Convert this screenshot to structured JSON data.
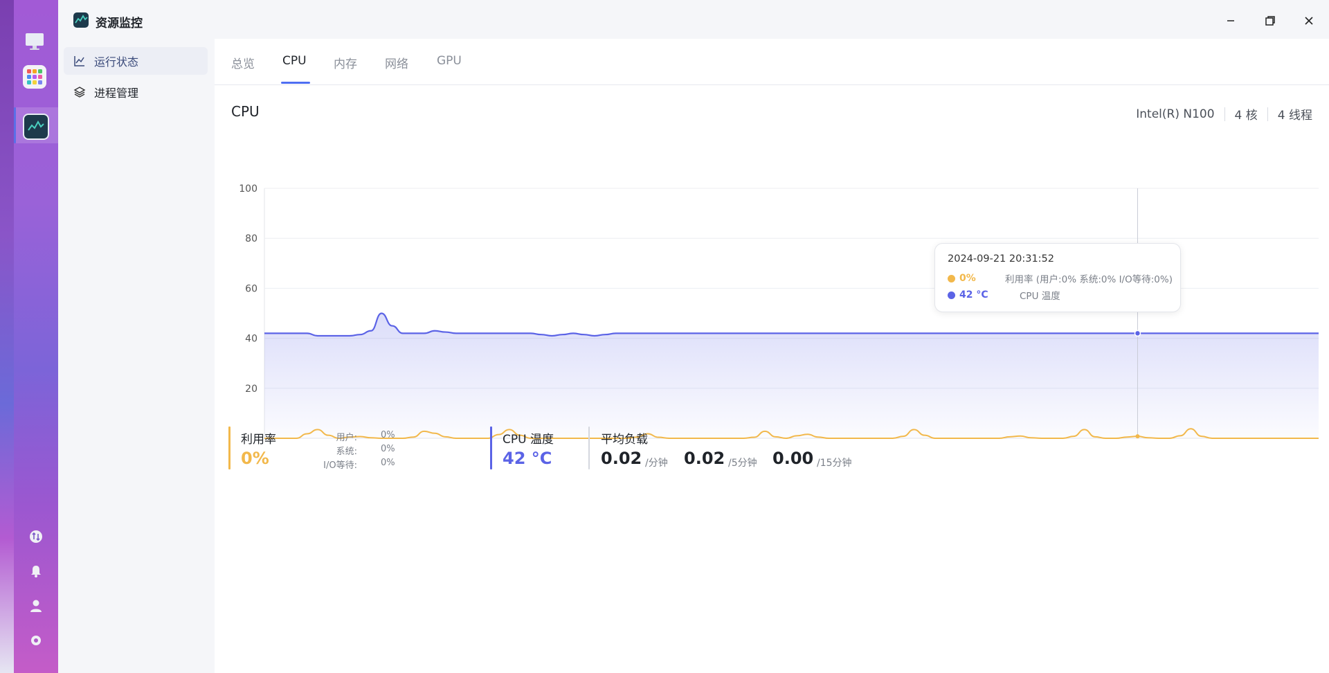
{
  "app": {
    "title": "资源监控"
  },
  "sidebar": {
    "items": [
      {
        "label": "运行状态",
        "icon": "line-chart-icon",
        "active": true
      },
      {
        "label": "进程管理",
        "icon": "layers-icon",
        "active": false
      }
    ]
  },
  "tabs": [
    {
      "label": "总览",
      "active": false
    },
    {
      "label": "CPU",
      "active": true
    },
    {
      "label": "内存",
      "active": false
    },
    {
      "label": "网络",
      "active": false
    },
    {
      "label": "GPU",
      "active": false
    }
  ],
  "cpu": {
    "section_title": "CPU",
    "model": "Intel(R) N100",
    "cores": "4 核",
    "threads": "4 线程"
  },
  "colors": {
    "usage": "#f2b84b",
    "temperature": "#5b63e6",
    "accent": "#4e6ef2"
  },
  "chart_data": {
    "type": "area",
    "y_ticks": [
      "100",
      "80",
      "60",
      "40",
      "20"
    ],
    "ylim": [
      0,
      100
    ],
    "grid": true,
    "series": [
      {
        "name": "CPU 温度",
        "values": [
          42,
          42,
          42,
          42,
          42,
          41,
          41,
          41,
          41,
          41.5,
          43,
          50,
          45,
          42,
          42,
          42,
          43,
          42.5,
          42,
          42,
          42,
          42,
          42,
          42,
          42,
          42,
          41.5,
          41,
          41.5,
          42,
          41.5,
          41,
          41.5,
          42,
          42,
          42,
          42,
          42,
          42,
          42,
          42,
          42,
          42,
          42,
          42,
          42,
          42,
          42,
          42,
          42,
          42,
          42,
          42,
          42,
          42,
          42,
          42,
          42,
          42,
          42,
          42,
          42,
          42,
          42,
          42,
          42,
          42,
          42,
          42,
          42,
          42,
          42,
          42,
          42,
          42,
          42,
          42,
          42,
          42,
          42,
          42,
          42,
          42,
          42,
          42,
          42,
          42,
          42,
          42,
          42,
          42,
          42,
          42,
          42,
          42,
          42,
          42,
          42,
          42,
          42
        ]
      },
      {
        "name": "利用率",
        "values": [
          0,
          0,
          0,
          0,
          1.8,
          3.5,
          1.2,
          0,
          0.5,
          0.7,
          0.2,
          0,
          0,
          0,
          0.5,
          2.8,
          2,
          0.6,
          0,
          0,
          0,
          0,
          1.5,
          3.5,
          1.2,
          0,
          0,
          0,
          0,
          0,
          0,
          0,
          0,
          0,
          0,
          0.5,
          1.8,
          0.4,
          0,
          0,
          0,
          0,
          0,
          0,
          0,
          0,
          0.4,
          2.8,
          0.6,
          0,
          1,
          1.6,
          0.5,
          0,
          0,
          0,
          0,
          0,
          0,
          0,
          0.8,
          3.5,
          1.2,
          0,
          0,
          0,
          0,
          0,
          0,
          0,
          0.6,
          0.9,
          0.2,
          0,
          0,
          0,
          0.8,
          3.5,
          0.6,
          0,
          0,
          0.5,
          0.8,
          0.2,
          0,
          0,
          1,
          3.8,
          0.8,
          0,
          0,
          0,
          0,
          0,
          0,
          0,
          0,
          0,
          0,
          0
        ]
      }
    ],
    "tooltip": {
      "time": "2024-09-21 20:31:52",
      "usage_value": "0%",
      "usage_label": "利用率 (用户:0% 系统:0% I/O等待:0%)",
      "temp_value": "42 °C",
      "temp_label": "CPU 温度"
    }
  },
  "stats": {
    "usage": {
      "label": "利用率",
      "value": "0%",
      "user_label": "用户:",
      "user_value": "0%",
      "system_label": "系统:",
      "system_value": "0%",
      "iowait_label": "I/O等待:",
      "iowait_value": "0%"
    },
    "temperature": {
      "label": "CPU 温度",
      "value": "42 °C"
    },
    "load": {
      "label": "平均负载",
      "one": "0.02",
      "one_unit": "/分钟",
      "five": "0.02",
      "five_unit": "/5分钟",
      "fifteen": "0.00",
      "fifteen_unit": "/15分钟"
    }
  }
}
